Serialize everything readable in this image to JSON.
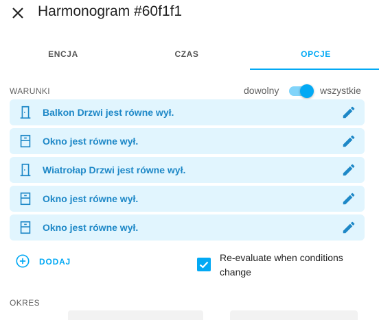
{
  "dialog": {
    "title": "Harmonogram #60f1f1",
    "close_icon": "close-icon"
  },
  "tabs": [
    {
      "label": "ENCJA",
      "active": false
    },
    {
      "label": "CZAS",
      "active": false
    },
    {
      "label": "OPCJE",
      "active": true
    }
  ],
  "conditions": {
    "section_label": "WARUNKI",
    "toggle": {
      "left_label": "dowolny",
      "right_label": "wszystkie",
      "state": "wszystkie"
    },
    "items": [
      {
        "text": "Balkon Drzwi jest równe wył.",
        "icon": "door-icon"
      },
      {
        "text": "Okno jest równe wył.",
        "icon": "window-icon"
      },
      {
        "text": "Wiatrołap Drzwi jest równe wył.",
        "icon": "door-icon"
      },
      {
        "text": "Okno jest równe wył.",
        "icon": "window-icon"
      },
      {
        "text": "Okno jest równe wył.",
        "icon": "window-icon"
      }
    ],
    "edit_icon": "pencil-icon",
    "add_label": "DODAJ",
    "reevaluate": {
      "label": "Re-evaluate when conditions change",
      "checked": true
    }
  },
  "period": {
    "section_label": "OKRES"
  },
  "colors": {
    "accent": "#03a9f4",
    "row_background": "#e1f5fe",
    "row_text": "#1e88c7"
  }
}
